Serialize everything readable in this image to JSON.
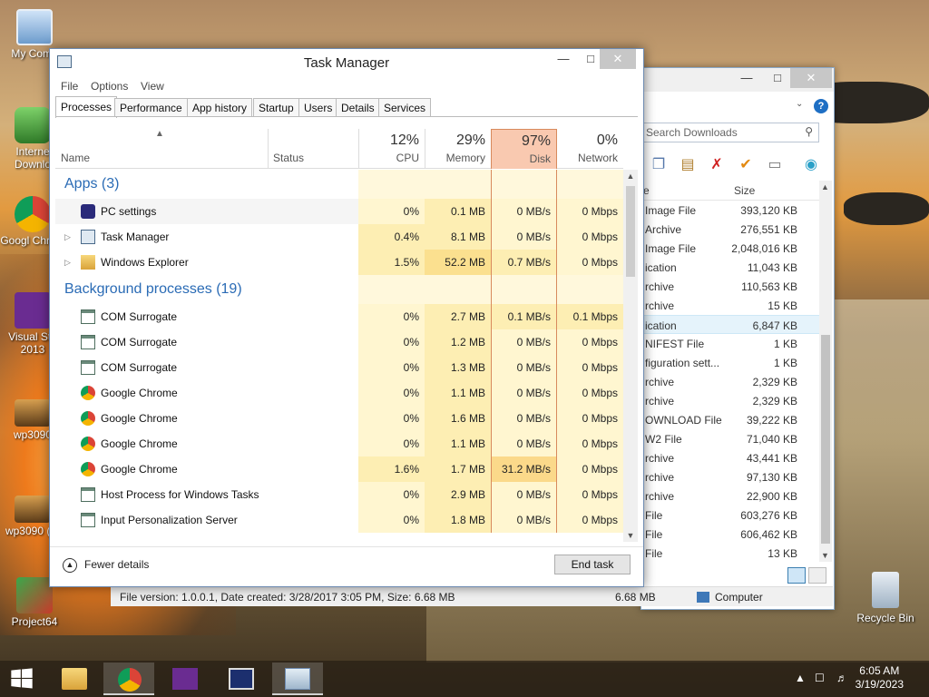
{
  "desktop": {
    "icons": [
      {
        "label": "My Comp",
        "icon": "computer-icon"
      },
      {
        "label": "Interne Downlo",
        "icon": "download-manager-icon"
      },
      {
        "label": "Googl Chrom",
        "icon": "chrome-icon"
      },
      {
        "label": "Visual Stu 2013",
        "icon": "visual-studio-icon"
      },
      {
        "label": "wp3090",
        "icon": "image-icon"
      },
      {
        "label": "wp3090 (1)",
        "icon": "image-icon"
      },
      {
        "label": "Project64",
        "icon": "project64-icon"
      }
    ],
    "recycle_bin": "Recycle Bin"
  },
  "task_manager": {
    "title": "Task Manager",
    "menu": [
      "File",
      "Options",
      "View"
    ],
    "tabs": [
      "Processes",
      "Performance",
      "App history",
      "Startup",
      "Users",
      "Details",
      "Services"
    ],
    "active_tab": "Processes",
    "columns": {
      "name": "Name",
      "status": "Status",
      "cpu": {
        "pct": "12%",
        "label": "CPU"
      },
      "memory": {
        "pct": "29%",
        "label": "Memory"
      },
      "disk": {
        "pct": "97%",
        "label": "Disk"
      },
      "network": {
        "pct": "0%",
        "label": "Network"
      }
    },
    "groups": {
      "apps": "Apps (3)",
      "background": "Background processes (19)"
    },
    "apps": [
      {
        "name": "PC settings",
        "cpu": "0%",
        "mem": "0.1 MB",
        "disk": "0 MB/s",
        "net": "0 Mbps",
        "icon": "gear-icon"
      },
      {
        "name": "Task Manager",
        "cpu": "0.4%",
        "mem": "8.1 MB",
        "disk": "0 MB/s",
        "net": "0 Mbps",
        "icon": "task-manager-icon"
      },
      {
        "name": "Windows Explorer",
        "cpu": "1.5%",
        "mem": "52.2 MB",
        "disk": "0.7 MB/s",
        "net": "0 Mbps",
        "icon": "folder-icon"
      }
    ],
    "background": [
      {
        "name": "COM Surrogate",
        "cpu": "0%",
        "mem": "2.7 MB",
        "disk": "0.1 MB/s",
        "net": "0.1 Mbps",
        "icon": "window-icon"
      },
      {
        "name": "COM Surrogate",
        "cpu": "0%",
        "mem": "1.2 MB",
        "disk": "0 MB/s",
        "net": "0 Mbps",
        "icon": "window-icon"
      },
      {
        "name": "COM Surrogate",
        "cpu": "0%",
        "mem": "1.3 MB",
        "disk": "0 MB/s",
        "net": "0 Mbps",
        "icon": "window-icon"
      },
      {
        "name": "Google Chrome",
        "cpu": "0%",
        "mem": "1.1 MB",
        "disk": "0 MB/s",
        "net": "0 Mbps",
        "icon": "chrome-icon"
      },
      {
        "name": "Google Chrome",
        "cpu": "0%",
        "mem": "1.6 MB",
        "disk": "0 MB/s",
        "net": "0 Mbps",
        "icon": "chrome-icon"
      },
      {
        "name": "Google Chrome",
        "cpu": "0%",
        "mem": "1.1 MB",
        "disk": "0 MB/s",
        "net": "0 Mbps",
        "icon": "chrome-icon"
      },
      {
        "name": "Google Chrome",
        "cpu": "1.6%",
        "mem": "1.7 MB",
        "disk": "31.2 MB/s",
        "net": "0 Mbps",
        "icon": "chrome-icon"
      },
      {
        "name": "Host Process for Windows Tasks",
        "cpu": "0%",
        "mem": "2.9 MB",
        "disk": "0 MB/s",
        "net": "0 Mbps",
        "icon": "window-icon"
      },
      {
        "name": "Input Personalization Server",
        "cpu": "0%",
        "mem": "1.8 MB",
        "disk": "0 MB/s",
        "net": "0 Mbps",
        "icon": "window-icon"
      }
    ],
    "footer": {
      "fewer_details": "Fewer details",
      "end_task": "End task"
    },
    "colors": {
      "disk_header": "#f9c9b0",
      "cell_heat_low": "#fff4c4",
      "cell_heat_mid": "#fbe49a",
      "group_text": "#2a6bb5"
    }
  },
  "explorer": {
    "search_placeholder": "Search Downloads",
    "col_size": "Size",
    "col_type_fragment": "e",
    "rows": [
      {
        "type": "Image File",
        "size": "393,120 KB"
      },
      {
        "type": "Archive",
        "size": "276,551 KB"
      },
      {
        "type": "Image File",
        "size": "2,048,016 KB"
      },
      {
        "type": "ication",
        "size": "11,043 KB"
      },
      {
        "type": "rchive",
        "size": "110,563 KB"
      },
      {
        "type": "rchive",
        "size": "15 KB"
      },
      {
        "type": "ication",
        "size": "6,847 KB"
      },
      {
        "type": "NIFEST File",
        "size": "1 KB"
      },
      {
        "type": "figuration sett...",
        "size": "1 KB"
      },
      {
        "type": "rchive",
        "size": "2,329 KB"
      },
      {
        "type": "rchive",
        "size": "2,329 KB"
      },
      {
        "type": "OWNLOAD File",
        "size": "39,222 KB"
      },
      {
        "type": "W2 File",
        "size": "71,040 KB"
      },
      {
        "type": "rchive",
        "size": "43,441 KB"
      },
      {
        "type": "rchive",
        "size": "97,130 KB"
      },
      {
        "type": "rchive",
        "size": "22,900 KB"
      },
      {
        "type": "File",
        "size": "603,276 KB"
      },
      {
        "type": "File",
        "size": "606,462 KB"
      },
      {
        "type": "File",
        "size": "13 KB"
      }
    ],
    "selected_index": 6,
    "status_left": "File version: 1.0.0.1, Date created: 3/28/2017 3:05 PM, Size: 6.68 MB",
    "status_size": "6.68 MB",
    "status_location": "Computer"
  },
  "taskbar": {
    "items": [
      "start-icon",
      "file-explorer-icon",
      "chrome-icon",
      "visual-studio-icon",
      "computer-icon",
      "task-manager-icon"
    ],
    "active_index": 2,
    "time": "6:05 AM",
    "date": "3/19/2023"
  }
}
